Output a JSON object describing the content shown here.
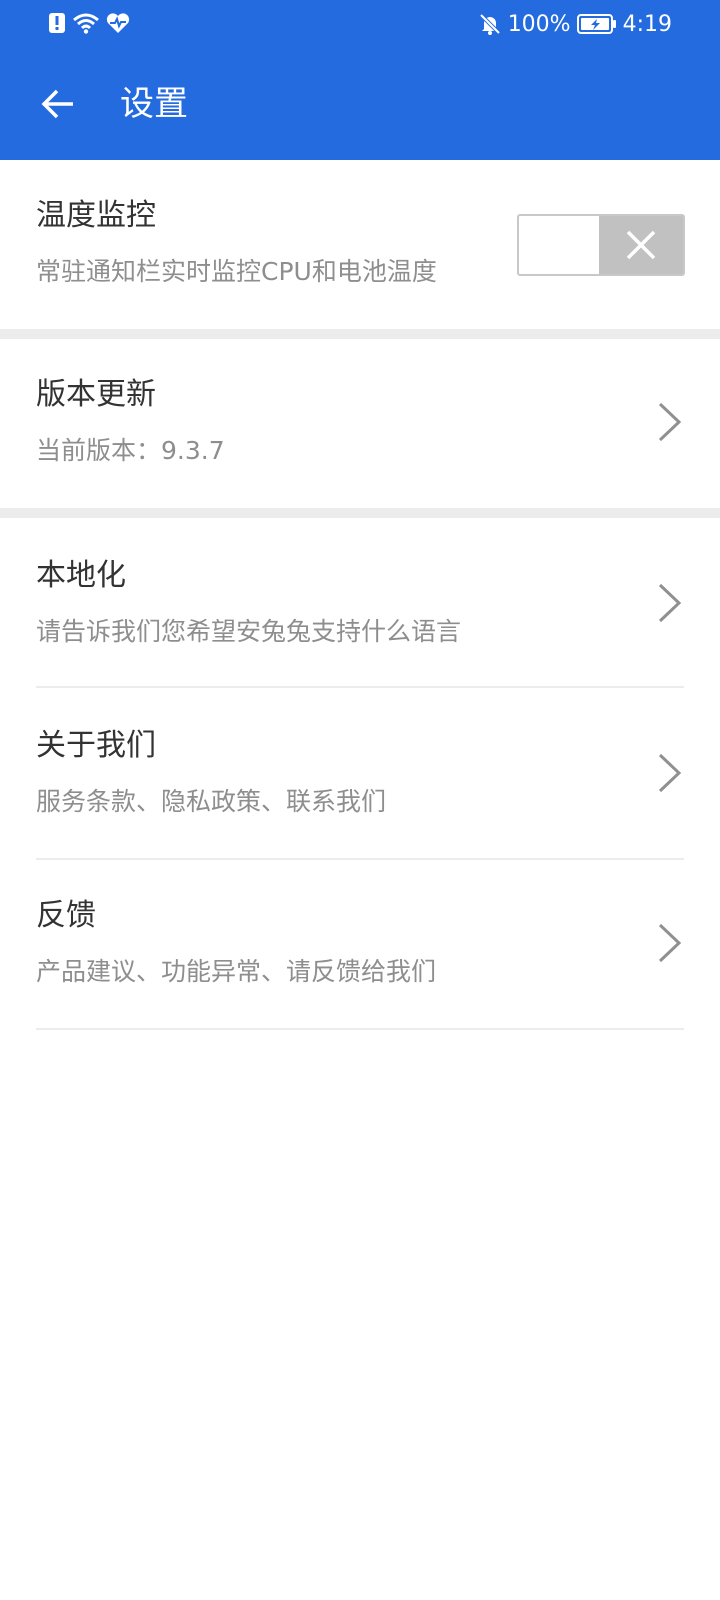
{
  "status_bar": {
    "battery_percent": "100%",
    "time": "4:19",
    "icons": [
      "alert-icon",
      "wifi-icon",
      "health-icon",
      "mute-icon",
      "battery-icon"
    ]
  },
  "header": {
    "title": "设置",
    "back_icon": "arrow-left-icon",
    "background_color": "#246be0"
  },
  "settings": {
    "temperature_monitor": {
      "title": "温度监控",
      "subtitle": "常驻通知栏实时监控CPU和电池温度",
      "toggle_state": "off"
    },
    "version_update": {
      "title": "版本更新",
      "subtitle": "当前版本：9.3.7"
    },
    "localization": {
      "title": "本地化",
      "subtitle": "请告诉我们您希望安兔兔支持什么语言"
    },
    "about_us": {
      "title": "关于我们",
      "subtitle": "服务条款、隐私政策、联系我们"
    },
    "feedback": {
      "title": "反馈",
      "subtitle": "产品建议、功能异常、请反馈给我们"
    }
  }
}
